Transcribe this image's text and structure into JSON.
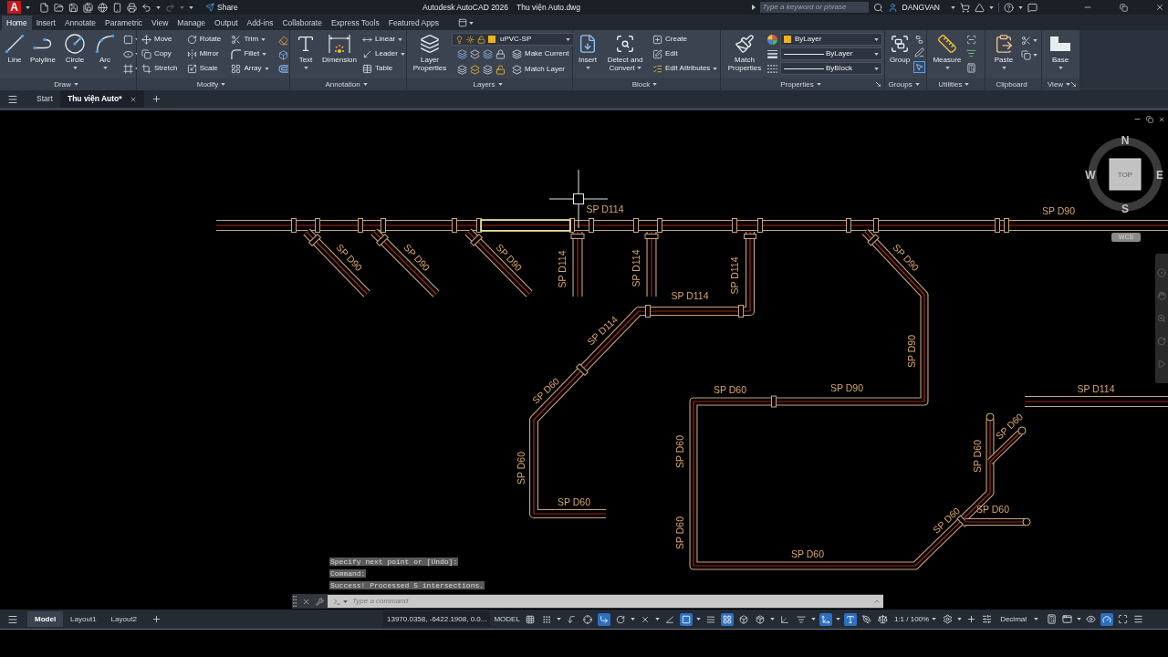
{
  "title_bar": {
    "logo": "A",
    "share": "Share",
    "app_name": "Autodesk AutoCAD 2026",
    "file_name": "Thu viện Auto.dwg",
    "search": {
      "placeholder": "Type a keyword or phrase"
    },
    "user": "DANGVAN"
  },
  "ribbon_tabs": [
    {
      "label": "Home",
      "selected": true
    },
    {
      "label": "Insert",
      "selected": false
    },
    {
      "label": "Annotate",
      "selected": false
    },
    {
      "label": "Parametric",
      "selected": false
    },
    {
      "label": "View",
      "selected": false
    },
    {
      "label": "Manage",
      "selected": false
    },
    {
      "label": "Output",
      "selected": false
    },
    {
      "label": "Add-ins",
      "selected": false
    },
    {
      "label": "Collaborate",
      "selected": false
    },
    {
      "label": "Express Tools",
      "selected": false
    },
    {
      "label": "Featured Apps",
      "selected": false
    }
  ],
  "ribbon_panels": {
    "draw": {
      "title": "Draw",
      "tools": [
        "Line",
        "Polyline",
        "Circle",
        "Arc"
      ]
    },
    "modify": {
      "title": "Modify",
      "tools": [
        "Move",
        "Copy",
        "Stretch",
        "Rotate",
        "Mirror",
        "Scale",
        "Trim",
        "Fillet",
        "Array"
      ]
    },
    "annotation": {
      "title": "Annotation",
      "tools": [
        "Text",
        "Dimension",
        "Linear",
        "Leader",
        "Table"
      ]
    },
    "layers": {
      "title": "Layers",
      "tools": [
        "Layer Properties",
        "Make Current",
        "Match Layer"
      ],
      "current_layer": {
        "value": "uPVC-SP",
        "color": "#f0b21a"
      }
    },
    "block": {
      "title": "Block",
      "tools": [
        "Insert",
        "Detect and Convert",
        "Create",
        "Edit",
        "Edit Attributes"
      ]
    },
    "properties": {
      "title": "Properties",
      "tools": [
        "Match Properties"
      ],
      "color": {
        "value": "ByLayer",
        "color": "#f0b21a"
      },
      "lineweight": "ByLayer",
      "linetype": "ByBlock"
    },
    "groups": {
      "title": "Groups",
      "tools": [
        "Group"
      ],
      "group_selection": {
        "on": true
      }
    },
    "utilities": {
      "title": "Utilities",
      "tools": [
        "Measure"
      ]
    },
    "clipboard": {
      "title": "Clipboard",
      "tools": [
        "Paste"
      ]
    },
    "view": {
      "title": "View",
      "tools": [
        "Base"
      ]
    }
  },
  "file_tabs": [
    {
      "label": "Start",
      "selected": false
    },
    {
      "label": "Thu viện Auto*",
      "selected": true
    }
  ],
  "drawing": {
    "hover_highlight": true,
    "labels": [
      "SP D114",
      "SP D90",
      "SP D90",
      "SP D90",
      "SP D90",
      "SP D114",
      "SP D114",
      "SP D114",
      "SP D90",
      "SP D114",
      "SP D114",
      "SP D90",
      "SP D60",
      "SP D60",
      "SP D90",
      "SP D114",
      "SP D60",
      "SP D60",
      "SP D60",
      "SP D60",
      "SP D60",
      "SP D60",
      "SP D60",
      "SP D60",
      "SP D60"
    ]
  },
  "viewcube": {
    "north": "N",
    "west": "W",
    "east": "E",
    "south": "S",
    "face": "TOP",
    "ucs": "WCS"
  },
  "command_line": {
    "history": [
      "Specify next point or [Undo]:",
      "Command:",
      "Success! Processed 5 intersections."
    ],
    "placeholder": "Type a command"
  },
  "status_bar": {
    "layout_tabs": [
      {
        "label": "Model",
        "selected": true
      },
      {
        "label": "Layout1",
        "selected": false
      },
      {
        "label": "Layout2",
        "selected": false
      }
    ],
    "coordinates": "13970.0358, -6422.1908, 0.0...",
    "space": "MODEL",
    "toggles": [
      {
        "on": false
      },
      {
        "on": false
      },
      {
        "on": false
      },
      {
        "on": false
      },
      {
        "on": true
      },
      {
        "on": false
      },
      {
        "on": false
      },
      {
        "on": false
      },
      {
        "on": true
      },
      {
        "on": false
      },
      {
        "on": true
      },
      {
        "on": false
      },
      {
        "on": false
      },
      {
        "on": false
      },
      {
        "on": false
      },
      {
        "on": true
      },
      {
        "on": true
      },
      {
        "on": false
      },
      {
        "on": true
      }
    ],
    "annotation_scale": "1:1 / 100%",
    "units": "Decimal"
  }
}
